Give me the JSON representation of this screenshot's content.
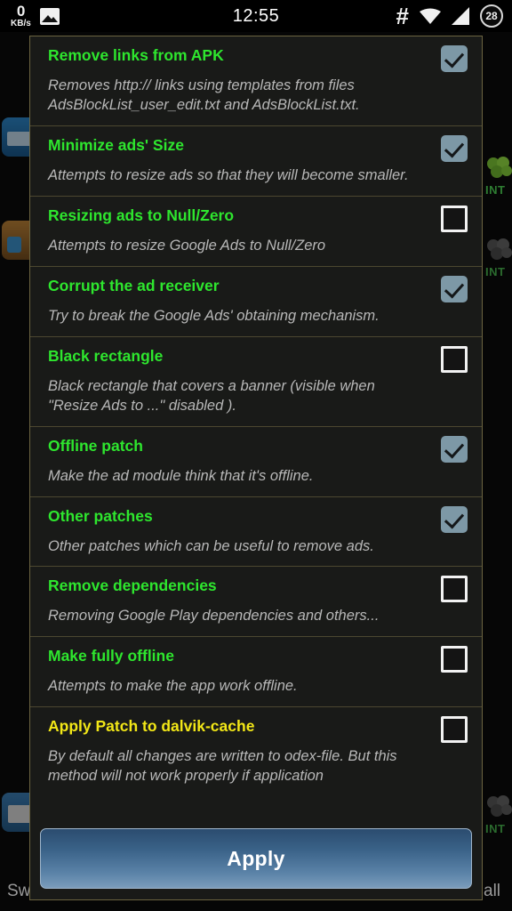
{
  "status_bar": {
    "net_speed_value": "0",
    "net_speed_unit": "KB/s",
    "image_icon": "image-icon",
    "clock": "12:55",
    "hash_icon": "hash-icon",
    "wifi_icon": "wifi-icon",
    "signal_icon": "signal-icon",
    "battery_level": "28"
  },
  "background": {
    "left_bottom_text": "Sw",
    "right_bottom_text": "all",
    "badges": [
      {
        "label": "INT"
      },
      {
        "label": "INT"
      },
      {
        "label": "INT"
      }
    ]
  },
  "dialog": {
    "options": [
      {
        "title": "Remove links from APK",
        "description": "Removes http:// links using templates from files AdsBlockList_user_edit.txt and AdsBlockList.txt.",
        "checked": true,
        "warn": false
      },
      {
        "title": "Minimize ads' Size",
        "description": "Attempts to resize ads so that they will become smaller.",
        "checked": true,
        "warn": false
      },
      {
        "title": "Resizing ads to Null/Zero",
        "description": "Attempts to resize Google Ads to Null/Zero",
        "checked": false,
        "warn": false
      },
      {
        "title": "Corrupt the ad receiver",
        "description": "Try to break the Google Ads' obtaining mechanism.",
        "checked": true,
        "warn": false
      },
      {
        "title": "Black rectangle",
        "description": "Black rectangle that covers a banner (visible when \"Resize Ads to ...\" disabled ).",
        "checked": false,
        "warn": false
      },
      {
        "title": "Offline patch",
        "description": "Make the ad module think that it's offline.",
        "checked": true,
        "warn": false
      },
      {
        "title": "Other patches",
        "description": "Other patches which can be useful to remove ads.",
        "checked": true,
        "warn": false
      },
      {
        "title": "Remove dependencies",
        "description": "Removing Google Play dependencies and others...",
        "checked": false,
        "warn": false
      },
      {
        "title": "Make fully offline",
        "description": "Attempts to make the app work offline.",
        "checked": false,
        "warn": false
      },
      {
        "title": "Apply Patch to dalvik-cache",
        "description": "By default all changes are written to odex-file. But this method will not work properly if application",
        "checked": false,
        "warn": true
      }
    ],
    "apply_label": "Apply"
  },
  "colors": {
    "option_title": "#2ee62e",
    "option_title_warn": "#f2e717",
    "description": "#b8b8b8",
    "checkbox_on": "#7d98a6",
    "dialog_bg": "#191a18",
    "divider": "#4c4730",
    "apply_button": "#3a6288"
  }
}
